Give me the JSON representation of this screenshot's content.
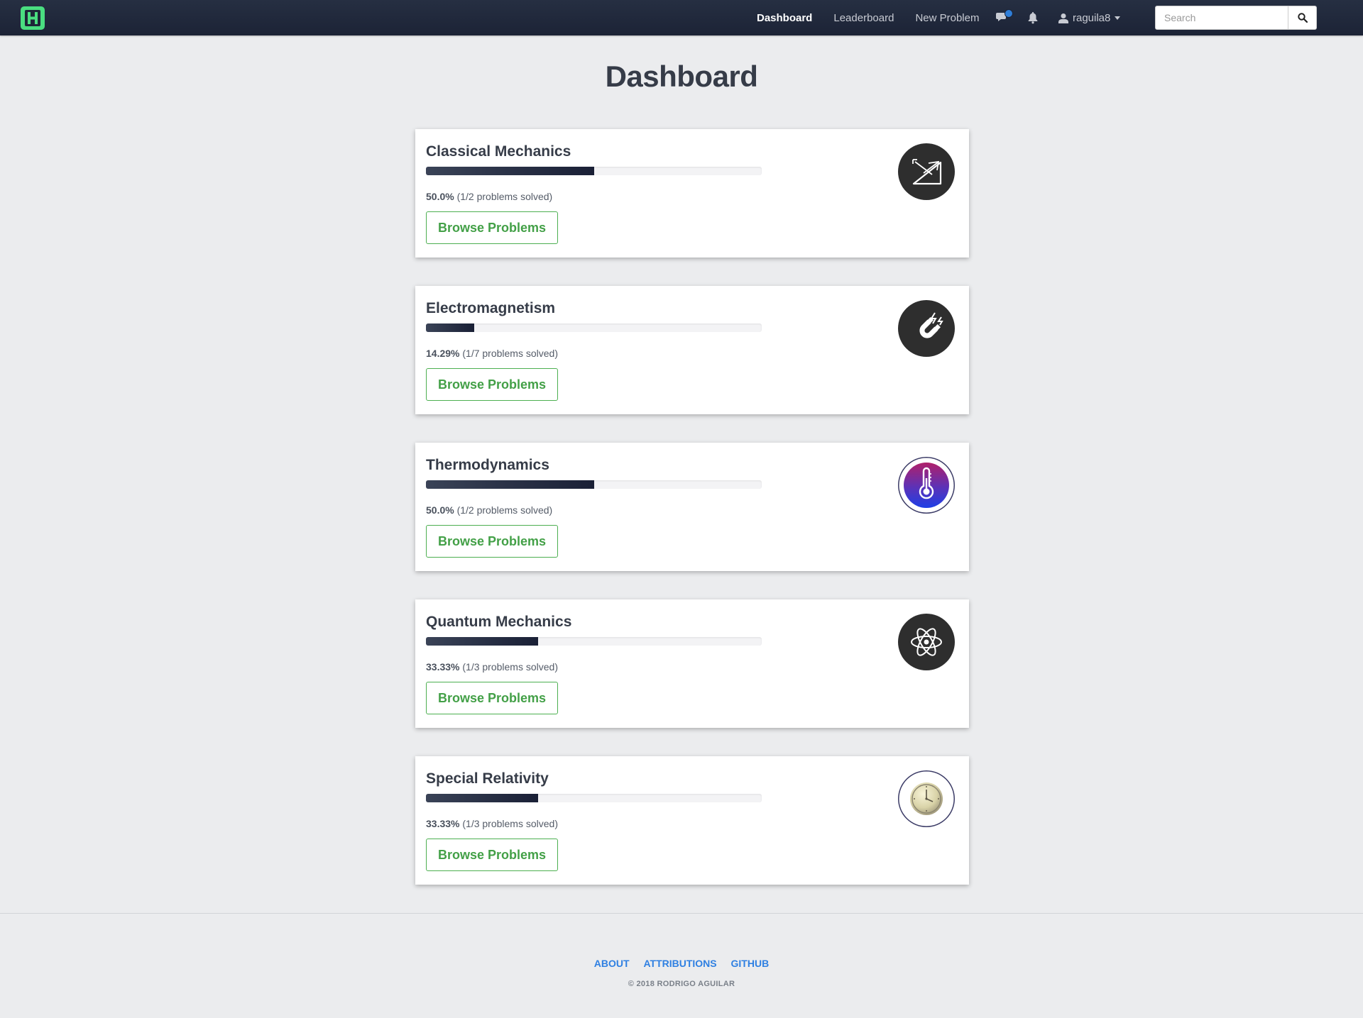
{
  "navbar": {
    "brand_letter": "H",
    "links": [
      {
        "label": "Dashboard",
        "active": true
      },
      {
        "label": "Leaderboard",
        "active": false
      },
      {
        "label": "New Problem",
        "active": false
      }
    ],
    "icons": [
      "chat-icon",
      "bell-icon",
      "user-icon",
      "search-icon"
    ],
    "username": "raguila8",
    "search_placeholder": "Search",
    "colors": {
      "background": "#1f2638",
      "brand": "#4ade80",
      "notification_dot": "#2f7ed8"
    }
  },
  "page": {
    "title": "Dashboard"
  },
  "topics": [
    {
      "name": "Classical Mechanics",
      "percent_label": "50.0%",
      "detail": "(1/2 problems solved)",
      "progress": 0.5,
      "button": "Browse Problems",
      "icon": "incline-plane-icon"
    },
    {
      "name": "Electromagnetism",
      "percent_label": "14.29%",
      "detail": "(1/7 problems solved)",
      "progress": 0.1429,
      "button": "Browse Problems",
      "icon": "magnet-icon"
    },
    {
      "name": "Thermodynamics",
      "percent_label": "50.0%",
      "detail": "(1/2 problems solved)",
      "progress": 0.5,
      "button": "Browse Problems",
      "icon": "thermometer-icon"
    },
    {
      "name": "Quantum Mechanics",
      "percent_label": "33.33%",
      "detail": "(1/3 problems solved)",
      "progress": 0.3333,
      "button": "Browse Problems",
      "icon": "atom-icon"
    },
    {
      "name": "Special Relativity",
      "percent_label": "33.33%",
      "detail": "(1/3 problems solved)",
      "progress": 0.3333,
      "button": "Browse Problems",
      "icon": "clock-icon"
    }
  ],
  "colors": {
    "button_green": "#43a047",
    "progress_fill": "#1f2638",
    "page_background": "#ebecee"
  },
  "footer": {
    "links": [
      "ABOUT",
      "ATTRIBUTIONS",
      "GITHUB"
    ],
    "copyright": "© 2018 RODRIGO AGUILAR"
  }
}
